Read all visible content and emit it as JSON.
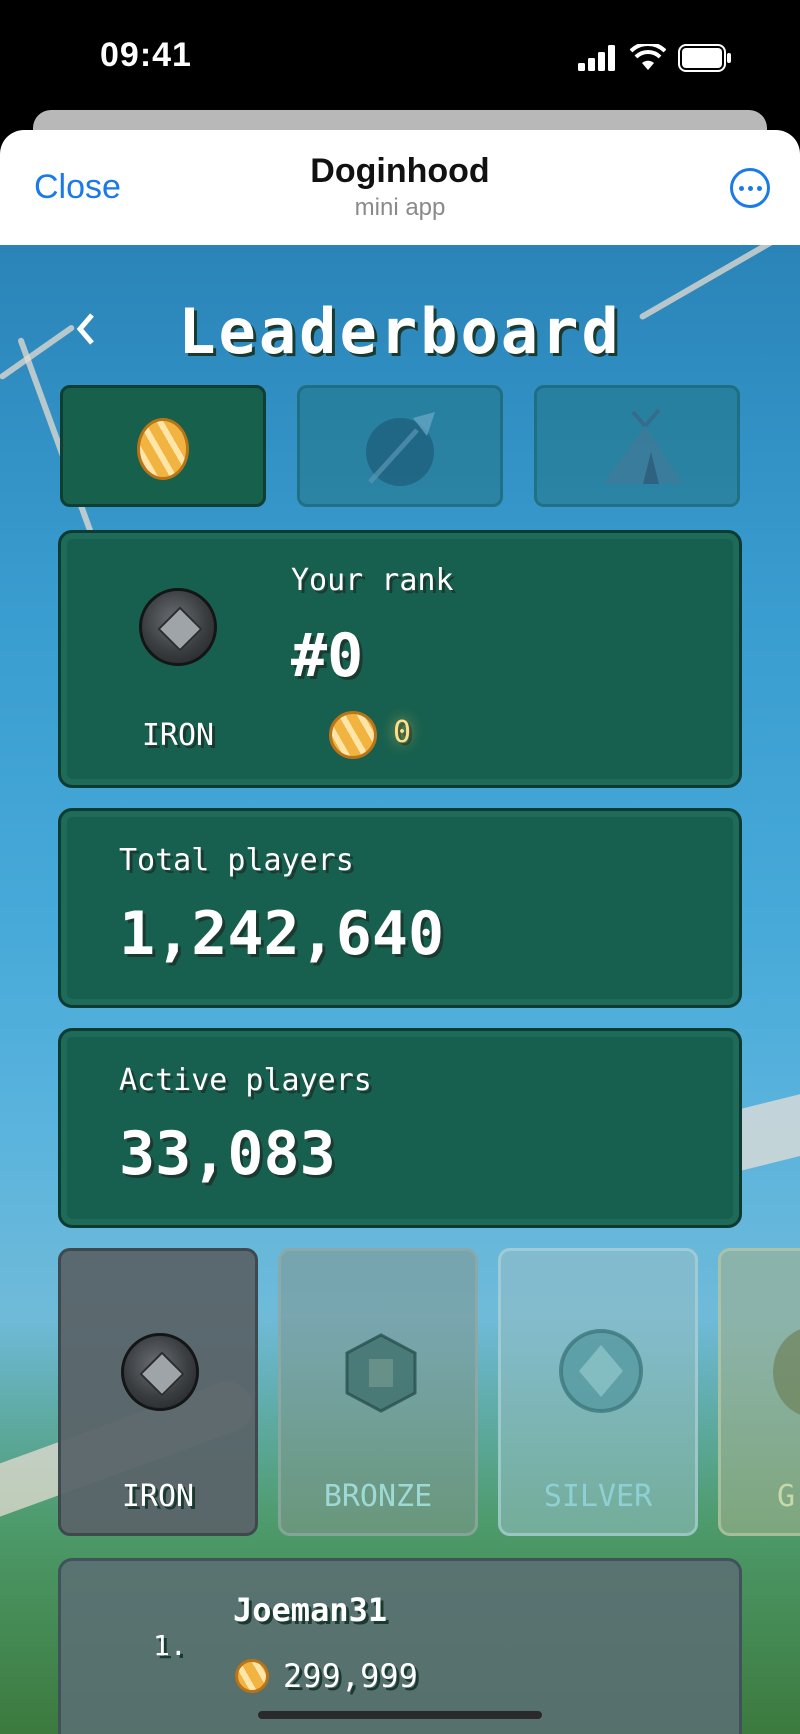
{
  "status_bar": {
    "time": "09:41"
  },
  "sheet": {
    "close_label": "Close",
    "title": "Doginhood",
    "subtitle": "mini app"
  },
  "page": {
    "title": "Leaderboard"
  },
  "tabs": [
    {
      "icon": "coin-icon",
      "active": true
    },
    {
      "icon": "spear-icon",
      "active": false
    },
    {
      "icon": "tent-icon",
      "active": false
    }
  ],
  "rank_card": {
    "league": "IRON",
    "label": "Your rank",
    "rank": "#0",
    "coins": "0"
  },
  "total_players": {
    "label": "Total players",
    "value": "1,242,640"
  },
  "active_players": {
    "label": "Active players",
    "value": "33,083"
  },
  "leagues": [
    {
      "label": "IRON",
      "active": true
    },
    {
      "label": "BRONZE",
      "active": false
    },
    {
      "label": "SILVER",
      "active": false
    },
    {
      "label": "G",
      "active": false
    }
  ],
  "players": [
    {
      "position": "1.",
      "name": "Joeman31",
      "coins": "299,999"
    }
  ],
  "colors": {
    "card": "#17604f",
    "link_blue": "#1a7ae8",
    "coin_gold": "#f2b440"
  }
}
